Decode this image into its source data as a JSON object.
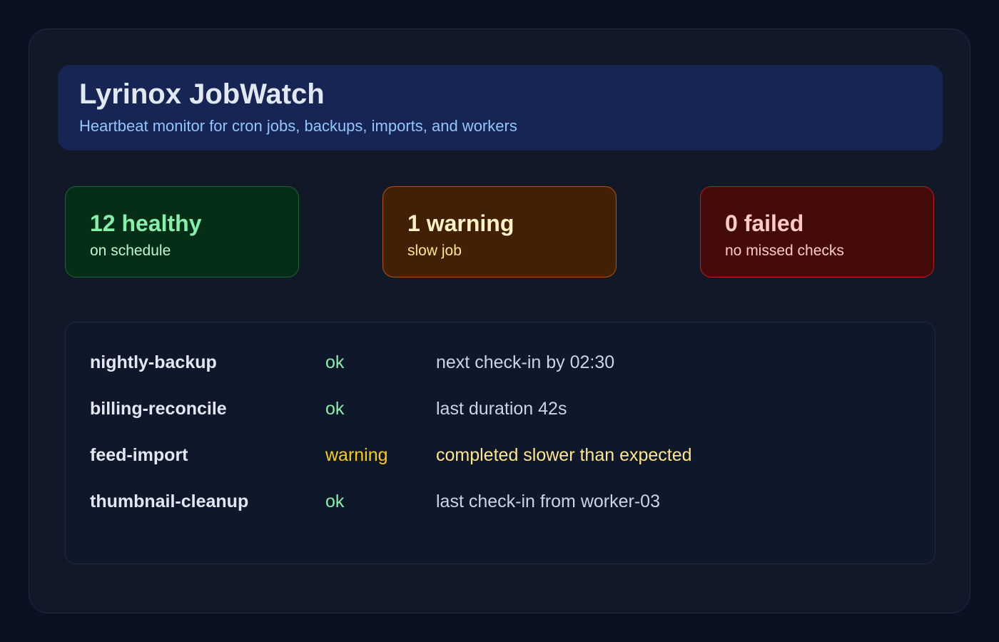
{
  "app": {
    "title": "Lyrinox JobWatch",
    "subtitle": "Heartbeat monitor for cron jobs, backups, imports, and workers"
  },
  "summary": {
    "healthy": {
      "value": "12 healthy",
      "label": "on schedule",
      "color": "#86efac"
    },
    "warning": {
      "value": "1 warning",
      "label": "slow job",
      "color": "#fef3c7"
    },
    "failed": {
      "value": "0 failed",
      "label": "no missed checks",
      "color": "#fecaca"
    }
  },
  "jobs": [
    {
      "name": "nightly-backup",
      "status": "ok",
      "detail": "next check-in by 02:30",
      "level": "ok"
    },
    {
      "name": "billing-reconcile",
      "status": "ok",
      "detail": "last duration 42s",
      "level": "ok"
    },
    {
      "name": "feed-import",
      "status": "warning",
      "detail": "completed slower than expected",
      "level": "warning"
    },
    {
      "name": "thumbnail-cleanup",
      "status": "ok",
      "detail": "last check-in from worker-03",
      "level": "ok"
    }
  ],
  "colors": {
    "background": "#0b1120",
    "panel": "#111827",
    "header": "#172554",
    "ok": "#86efac",
    "warning": "#facc15"
  }
}
